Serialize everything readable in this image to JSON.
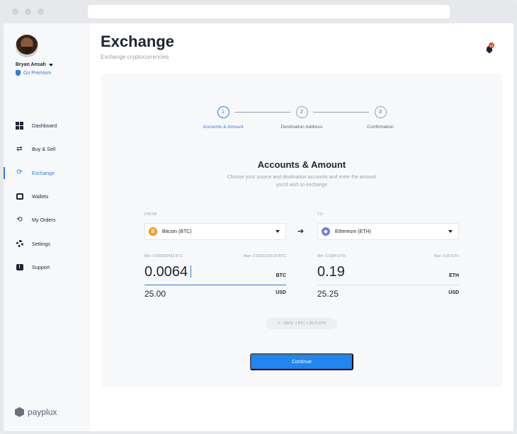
{
  "user": {
    "name": "Bryan Ansah",
    "premium_label": "Go Premium"
  },
  "nav": [
    {
      "label": "Dashboard",
      "icon": "dashboard-icon"
    },
    {
      "label": "Buy & Sell",
      "icon": "swap-arrows-icon"
    },
    {
      "label": "Exchange",
      "icon": "exchange-icon",
      "active": true
    },
    {
      "label": "Wallets",
      "icon": "wallet-icon"
    },
    {
      "label": "My Orders",
      "icon": "history-icon"
    },
    {
      "label": "Settings",
      "icon": "gear-icon"
    },
    {
      "label": "Support",
      "icon": "support-icon"
    }
  ],
  "brand": {
    "name": "payplux"
  },
  "header": {
    "title": "Exchange",
    "subtitle": "Exchange cryptocurrencies",
    "notification_count": "12"
  },
  "steps": [
    {
      "number": "1",
      "label": "Accounts & Amount",
      "active": true
    },
    {
      "number": "2",
      "label": "Destination Address"
    },
    {
      "number": "3",
      "label": "Confirmation"
    }
  ],
  "section": {
    "title": "Accounts & Amount",
    "subtitle": "Choose your source and destination accounts and enter the amount you'd wish to exchange"
  },
  "from": {
    "label": "FROM",
    "currency": "Bitcoin (BTC)",
    "coin_symbol": "₿",
    "coin_color": "#f7931a",
    "min": "Min: 0.000255432 BTC",
    "max": "Max: 2.55322191Ο2 BTC",
    "amount": "0.0064",
    "unit": "BTC",
    "usd": "25.00",
    "usd_unit": "USD"
  },
  "to": {
    "label": "TO",
    "currency": "Ethereum (ETH)",
    "coin_symbol": "◆",
    "coin_color": "#6f7fd9",
    "min": "Min: 0.0384 ETH",
    "max": "Max: 6.55 ETH",
    "amount": "0.19",
    "unit": "ETH",
    "usd": "25.25",
    "usd_unit": "USD"
  },
  "rate": "RATE: 1 BTC = 29.70 ETH",
  "continue_label": "Continue"
}
